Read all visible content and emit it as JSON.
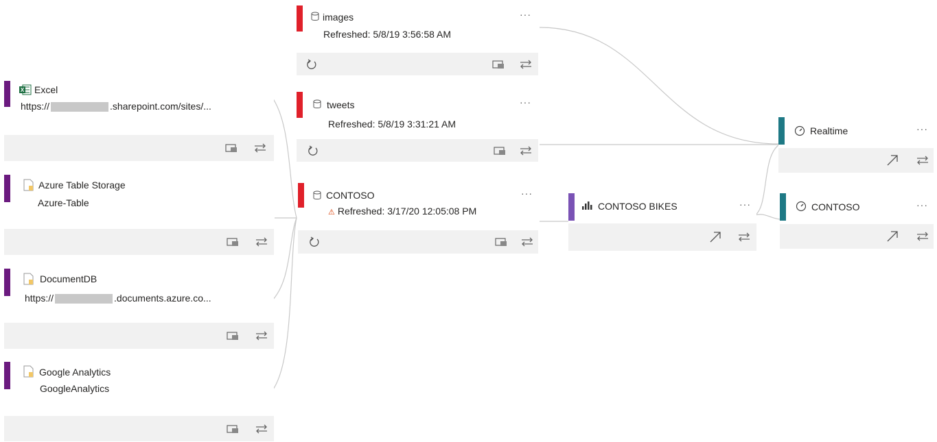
{
  "colors": {
    "source_accent": "#6b1a7f",
    "dataset_accent": "#e0202a",
    "report_accent": "#7a52b5",
    "dashboard_accent": "#1e7985",
    "footer_bg": "#f1f1f1",
    "link_line": "#c8c8c8"
  },
  "sources": [
    {
      "icon": "excel-icon",
      "title": "Excel",
      "url_prefix": "https://",
      "url_suffix": ".sharepoint.com/sites/..."
    },
    {
      "icon": "document-icon",
      "title": "Azure Table Storage",
      "subtitle": "Azure-Table"
    },
    {
      "icon": "document-icon",
      "title": "DocumentDB",
      "url_prefix": "https://",
      "url_suffix": ".documents.azure.co..."
    },
    {
      "icon": "document-icon",
      "title": "Google Analytics",
      "subtitle": "GoogleAnalytics"
    }
  ],
  "datasets": [
    {
      "icon": "database-icon",
      "title": "images",
      "refreshed": "Refreshed: 5/8/19 3:56:58 AM",
      "more": "···"
    },
    {
      "icon": "database-icon",
      "title": "tweets",
      "refreshed": "Refreshed: 5/8/19 3:31:21 AM",
      "more": "···"
    },
    {
      "icon": "database-icon",
      "title": "CONTOSO",
      "refreshed": "Refreshed: 3/17/20 12:05:08 PM",
      "warning": "⚠",
      "more": "···"
    }
  ],
  "reports": [
    {
      "icon": "bar-chart-icon",
      "title": "CONTOSO BIKES",
      "more": "···"
    }
  ],
  "dashboards": [
    {
      "icon": "gauge-icon",
      "title": "Realtime",
      "more": "···"
    },
    {
      "icon": "gauge-icon",
      "title": "CONTOSO",
      "more": "···"
    }
  ]
}
